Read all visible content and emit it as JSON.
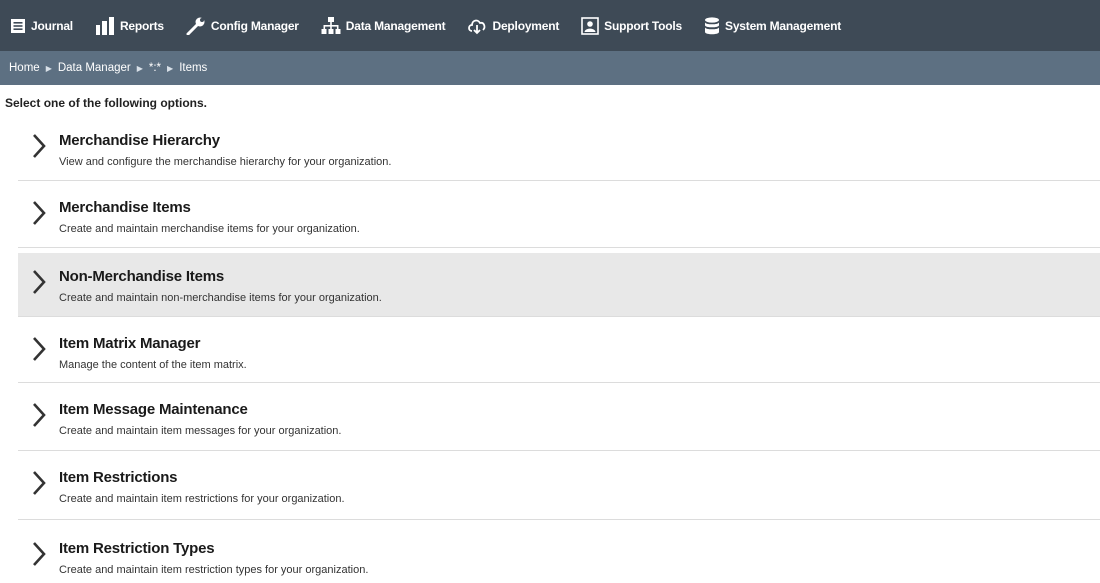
{
  "nav": [
    {
      "label": "Journal",
      "icon": "journal-icon"
    },
    {
      "label": "Reports",
      "icon": "reports-icon"
    },
    {
      "label": "Config Manager",
      "icon": "wrench-icon"
    },
    {
      "label": "Data Management",
      "icon": "hierarchy-icon"
    },
    {
      "label": "Deployment",
      "icon": "cloud-download-icon"
    },
    {
      "label": "Support Tools",
      "icon": "support-icon"
    },
    {
      "label": "System Management",
      "icon": "database-icon"
    }
  ],
  "breadcrumb": [
    "Home",
    "Data Manager",
    "*:*",
    "Items"
  ],
  "prompt": "Select one of the following options.",
  "options": [
    {
      "title": "Merchandise Hierarchy",
      "desc": "View and configure the merchandise hierarchy for your organization.",
      "highlighted": false
    },
    {
      "title": "Merchandise Items",
      "desc": "Create and maintain merchandise items for your organization.",
      "highlighted": false
    },
    {
      "title": "Non-Merchandise Items",
      "desc": "Create and maintain non-merchandise items for your organization.",
      "highlighted": true
    },
    {
      "title": "Item Matrix Manager",
      "desc": "Manage the content of the item matrix.",
      "highlighted": false
    },
    {
      "title": "Item Message Maintenance",
      "desc": "Create and maintain item messages for your organization.",
      "highlighted": false
    },
    {
      "title": "Item Restrictions",
      "desc": "Create and maintain item restrictions for your organization.",
      "highlighted": false
    },
    {
      "title": "Item Restriction Types",
      "desc": "Create and maintain item restriction types for your organization.",
      "highlighted": false
    }
  ],
  "colors": {
    "nav_bg": "#3e4a56",
    "breadcrumb_bg": "#5d7082",
    "highlight_bg": "#e8e8e8"
  }
}
